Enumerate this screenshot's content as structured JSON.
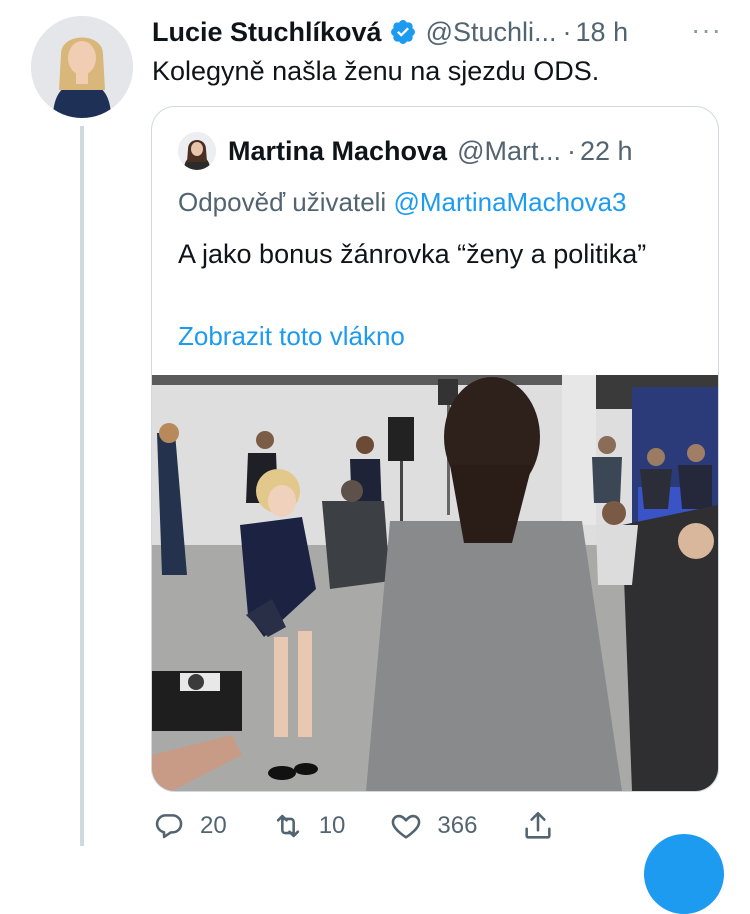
{
  "tweet": {
    "author_name": "Lucie Stuchlíková",
    "handle": "@Stuchli...",
    "separator": "·",
    "time": "18 h",
    "more_label": "···",
    "text": "Kolegyně našla ženu na sjezdu ODS.",
    "verified": true
  },
  "quote": {
    "author_name": "Martina Machova",
    "handle": "@Mart...",
    "separator": "·",
    "time": "22 h",
    "reply_prefix": "Odpověď uživateli",
    "reply_to": "@MartinaMachova3",
    "text": "A jako bonus žánrovka “ženy a politika”",
    "show_thread": "Zobrazit toto vlákno"
  },
  "actions": {
    "reply_count": "20",
    "retweet_count": "10",
    "like_count": "366"
  },
  "colors": {
    "accent": "#1d9bf0",
    "secondary_text": "#536471",
    "primary_text": "#0f1419",
    "border": "#cfd9de"
  },
  "icons": {
    "verified": "verified-badge-icon",
    "more": "more-horizontal-icon",
    "reply": "reply-bubble-icon",
    "retweet": "retweet-icon",
    "like": "heart-icon",
    "share": "share-icon"
  }
}
